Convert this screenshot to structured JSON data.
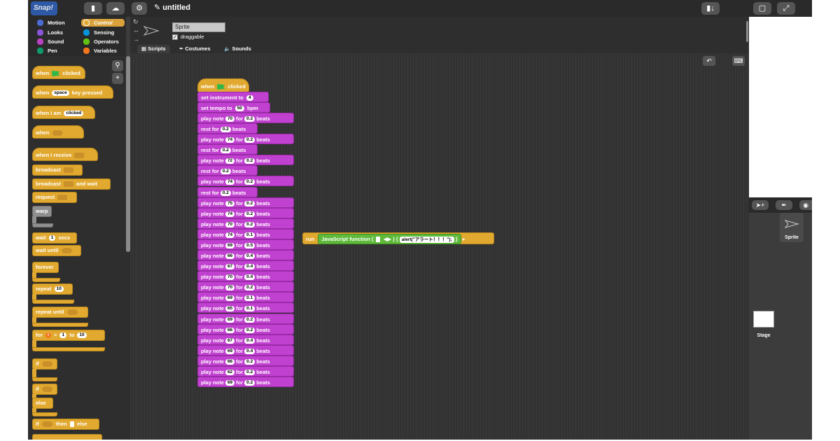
{
  "app": {
    "logo_text": "Snap!",
    "project_title": "✎ untitled"
  },
  "toolbar": {
    "file_icon": "file-icon",
    "cloud_icon": "cloud-icon",
    "settings_icon": "gear-icon"
  },
  "categories": [
    {
      "label": "Motion",
      "color": "#4a6cd4"
    },
    {
      "label": "Control",
      "color": "#e1a92f"
    },
    {
      "label": "Looks",
      "color": "#8a55d7"
    },
    {
      "label": "Sensing",
      "color": "#0494dc"
    },
    {
      "label": "Sound",
      "color": "#bb42c3"
    },
    {
      "label": "Operators",
      "color": "#62c213"
    },
    {
      "label": "Pen",
      "color": "#0e9a6c"
    },
    {
      "label": "Variables",
      "color": "#f3761d"
    }
  ],
  "palette": {
    "when_flag_clicked": {
      "a": "when",
      "b": "clicked"
    },
    "when_key": {
      "a": "when",
      "key": "space",
      "b": "key pressed"
    },
    "when_i_am": {
      "a": "when I am",
      "opt": "clicked"
    },
    "when_cond": "when",
    "when_receive": "when I receive",
    "broadcast": "broadcast",
    "broadcast_wait": {
      "a": "broadcast",
      "b": "and wait"
    },
    "request": "request",
    "warp": "warp",
    "wait": {
      "a": "wait",
      "n": "1",
      "b": "secs"
    },
    "wait_until": "wait until",
    "forever": "forever",
    "repeat": {
      "a": "repeat",
      "n": "10"
    },
    "repeat_until": "repeat until",
    "for": {
      "a": "for",
      "var": "i",
      "eq": "=",
      "from": "1",
      "to": "to",
      "n": "10"
    },
    "if": "if",
    "if_else": {
      "a": "if",
      "b": "else"
    },
    "if_then_else": {
      "a": "if",
      "b": "then",
      "c": "else"
    }
  },
  "sprite": {
    "name": "Sprite",
    "draggable_label": "draggable",
    "check_mark": "✓"
  },
  "tabs": [
    {
      "label": "Scripts",
      "active": true
    },
    {
      "label": "Costumes",
      "active": false
    },
    {
      "label": "Sounds",
      "active": false
    }
  ],
  "script": {
    "hat": {
      "a": "when",
      "b": "clicked"
    },
    "set_instrument": {
      "a": "set instrument to",
      "v": "4"
    },
    "set_tempo": {
      "a": "set tempo to",
      "v": "50",
      "b": "bpm"
    },
    "play_labels": {
      "a": "play note",
      "b": "for",
      "c": "beats"
    },
    "rest_labels": {
      "a": "rest for",
      "b": "beats"
    },
    "steps": [
      {
        "kind": "play",
        "note": "70",
        "beats": "0.2"
      },
      {
        "kind": "rest",
        "beats": "0.2"
      },
      {
        "kind": "play",
        "note": "74",
        "beats": "0.2"
      },
      {
        "kind": "rest",
        "beats": "0.2"
      },
      {
        "kind": "play",
        "note": "72",
        "beats": "0.2"
      },
      {
        "kind": "rest",
        "beats": "0.2"
      },
      {
        "kind": "play",
        "note": "74",
        "beats": "0.2"
      },
      {
        "kind": "rest",
        "beats": "0.2"
      },
      {
        "kind": "play",
        "note": "75",
        "beats": "0.2"
      },
      {
        "kind": "play",
        "note": "74",
        "beats": "0.2"
      },
      {
        "kind": "play",
        "note": "70",
        "beats": "0.2"
      },
      {
        "kind": "play",
        "note": "74",
        "beats": "0.1"
      },
      {
        "kind": "play",
        "note": "69",
        "beats": "0.5"
      },
      {
        "kind": "play",
        "note": "66",
        "beats": "0.4"
      },
      {
        "kind": "play",
        "note": "67",
        "beats": "0.4"
      },
      {
        "kind": "play",
        "note": "70",
        "beats": "0.4"
      },
      {
        "kind": "play",
        "note": "70",
        "beats": "0.2"
      },
      {
        "kind": "play",
        "note": "69",
        "beats": "0.1"
      },
      {
        "kind": "play",
        "note": "65",
        "beats": "0.1"
      },
      {
        "kind": "play",
        "note": "69",
        "beats": "0.2"
      },
      {
        "kind": "play",
        "note": "66",
        "beats": "0.2"
      },
      {
        "kind": "play",
        "note": "67",
        "beats": "0.4"
      },
      {
        "kind": "play",
        "note": "69",
        "beats": "0.4"
      },
      {
        "kind": "play",
        "note": "66",
        "beats": "0.2"
      },
      {
        "kind": "play",
        "note": "62",
        "beats": "0.2"
      },
      {
        "kind": "play",
        "note": "69",
        "beats": "0.2"
      }
    ]
  },
  "js_block": {
    "run": "run",
    "label": "JavaScript function (",
    "mid": ") {",
    "code": "alert(\"アラート！！！\");",
    "end": "}"
  },
  "corral": {
    "sprite_label": "Sprite",
    "stage_label": "Stage"
  }
}
